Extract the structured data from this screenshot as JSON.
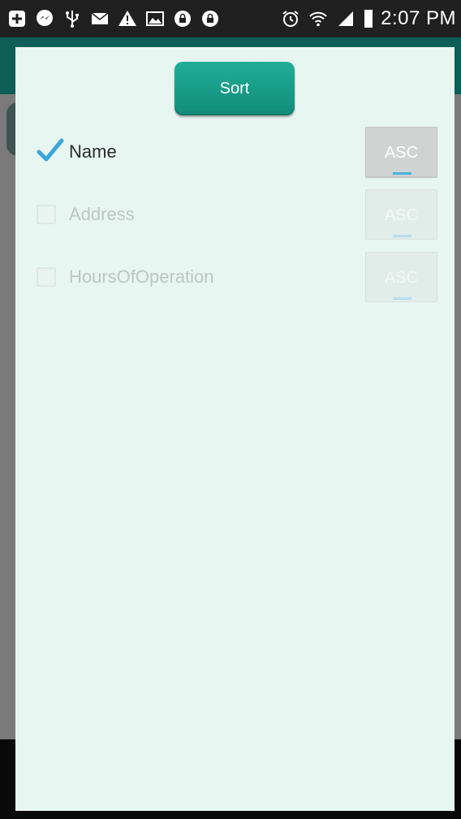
{
  "status_bar": {
    "time": "2:07 PM",
    "icons": [
      "plus-square-icon",
      "messenger-icon",
      "usb-icon",
      "email-icon",
      "warning-icon",
      "image-icon",
      "lock-app-icon",
      "lock-app-icon",
      "alarm-icon",
      "wifi-icon",
      "signal-icon",
      "battery-icon"
    ]
  },
  "dialog": {
    "sort_button_label": "Sort",
    "rows": [
      {
        "label": "Name",
        "checked": true,
        "order": "ASC"
      },
      {
        "label": "Address",
        "checked": false,
        "order": "ASC"
      },
      {
        "label": "HoursOfOperation",
        "checked": false,
        "order": "ASC"
      }
    ]
  },
  "colors": {
    "accent": "#1a9e8a",
    "dialog_background": "#e8f6f1",
    "checkmark": "#3aa6dd",
    "status_bar": "#202020"
  }
}
